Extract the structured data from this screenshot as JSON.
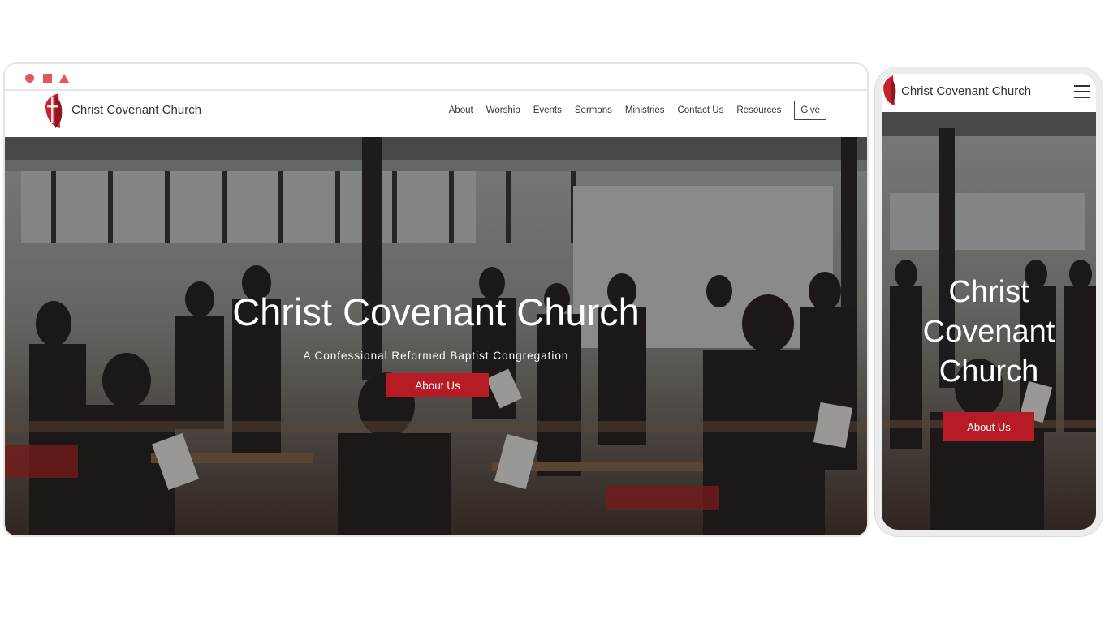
{
  "brand": {
    "name": "Christ Covenant Church",
    "accent": "#b71c26"
  },
  "desktop": {
    "window_controls": [
      "circle-icon",
      "square-icon",
      "triangle-icon"
    ],
    "nav": {
      "items": [
        "About",
        "Worship",
        "Events",
        "Sermons",
        "Ministries",
        "Contact Us",
        "Resources"
      ],
      "give_label": "Give"
    },
    "hero": {
      "title": "Christ Covenant Church",
      "subtitle": "A Confessional Reformed Baptist Congregation",
      "cta_label": "About Us"
    }
  },
  "mobile": {
    "header_title": "Christ Covenant Church",
    "menu_icon": "hamburger-icon",
    "hero": {
      "title_lines": [
        "Christ",
        "Covenant",
        "Church"
      ],
      "cta_label": "About Us"
    }
  }
}
